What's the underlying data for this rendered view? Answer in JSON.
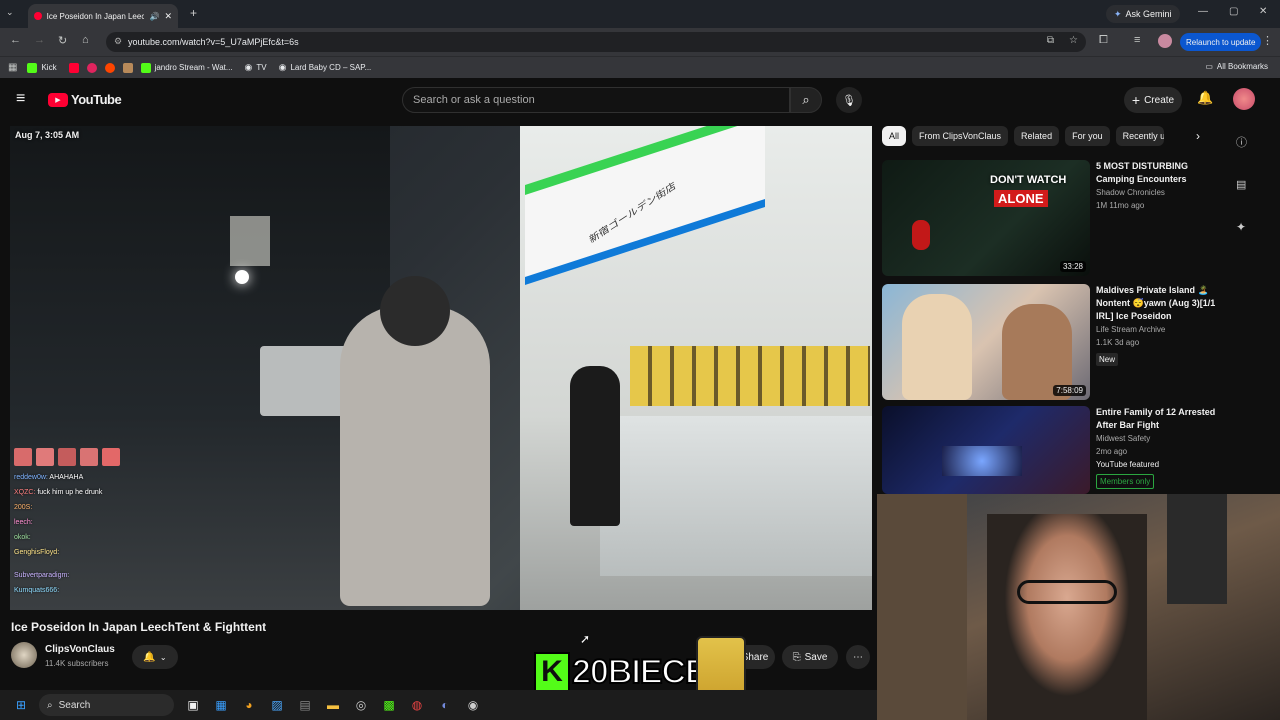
{
  "browser": {
    "tab_title": "Ice Poseidon In Japan Leech",
    "url": "youtube.com/watch?v=5_U7aMPjEfc&t=6s",
    "ask_gemini": "Ask Gemini",
    "relaunch": "Relaunch to update",
    "bookmarks": [
      "Kick",
      "jandro Stream - Wat...",
      "TV",
      "Lard Baby CD – SAP..."
    ],
    "all_bookmarks": "All Bookmarks"
  },
  "youtube": {
    "logo": "YouTube",
    "search_placeholder": "Search or ask a question",
    "create": "Create"
  },
  "video": {
    "timestamp": "Aug 7, 3:05 AM",
    "store_sign": "新宿ゴールデン街店",
    "title": "Ice Poseidon In Japan LeechTent & Fighttent",
    "channel": "ClipsVonClaus",
    "subscribers": "11.4K subscribers",
    "share": "Share",
    "save": "Save",
    "overlay_text": "20BIECE",
    "overlay_badge": "K"
  },
  "chat": [
    {
      "user": "reddew0w:",
      "msg": "AHAHAHA"
    },
    {
      "user": "XQZC:",
      "msg": "fuck him up he drunk"
    },
    {
      "user": "200S:",
      "msg": ""
    },
    {
      "user": "leech:",
      "msg": ""
    },
    {
      "user": "okok:",
      "msg": ""
    },
    {
      "user": "GenghisFloyd:",
      "msg": ""
    },
    {
      "user": "Subvertparadigm:",
      "msg": ""
    },
    {
      "user": "Kumquats666:",
      "msg": ""
    }
  ],
  "chips": [
    "All",
    "From ClipsVonClaus",
    "Related",
    "For you",
    "Recently up"
  ],
  "recommendations": [
    {
      "title": "5 MOST DISTURBING Camping Encounters",
      "channel": "Shadow Chronicles",
      "meta": "1M  11mo ago",
      "duration": "33:28",
      "thumb_text_1": "DON'T WATCH",
      "thumb_text_2": "ALONE"
    },
    {
      "title": "Maldives Private Island 🏝️ Nontent 😴yawn (Aug 3)[1/1 IRL] Ice Poseidon",
      "channel": "Life Stream Archive",
      "meta": "1.1K  3d ago",
      "badge": "New",
      "duration": "7:58:09"
    },
    {
      "title": "Entire Family of 12 Arrested After Bar Fight",
      "channel": "Midwest Safety",
      "meta": "2mo ago",
      "badge": "YouTube featured",
      "badge2": "Members only"
    }
  ],
  "taskbar": {
    "search": "Search"
  },
  "colors": {
    "accent_red": "#ff0033",
    "kick_green": "#53fc18",
    "members_green": "#2ba640"
  }
}
